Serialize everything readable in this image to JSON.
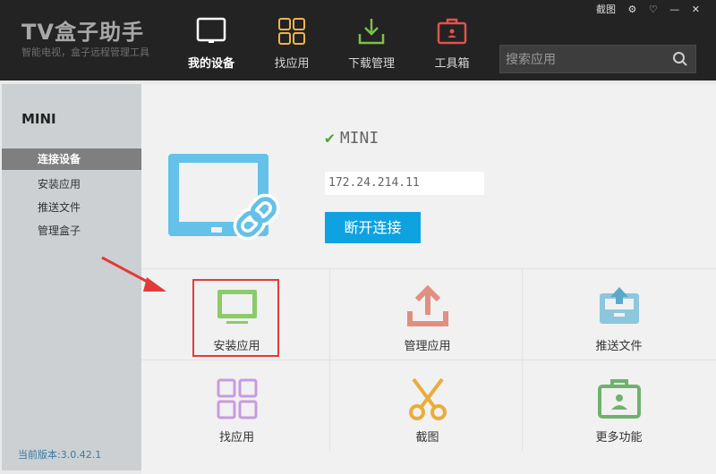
{
  "app": {
    "title": "TV盒子助手",
    "subtitle": "智能电视，盒子远程管理工具",
    "window_controls": [
      "截图",
      "⚙",
      "♡",
      "—",
      "✕"
    ]
  },
  "nav": [
    {
      "label": "我的设备",
      "icon": "tablet-icon",
      "active": true
    },
    {
      "label": "找应用",
      "icon": "grid-apps-icon",
      "active": false
    },
    {
      "label": "下载管理",
      "icon": "download-icon",
      "active": false
    },
    {
      "label": "工具箱",
      "icon": "toolbox-icon",
      "active": false
    }
  ],
  "search": {
    "placeholder": "搜索应用"
  },
  "sidebar": {
    "title": "MINI",
    "items": [
      {
        "label": "连接设备",
        "active": true
      },
      {
        "label": "安装应用",
        "active": false
      },
      {
        "label": "推送文件",
        "active": false
      },
      {
        "label": "管理盒子",
        "active": false
      }
    ],
    "version": "当前版本:3.0.42.1"
  },
  "device": {
    "name": "MINI",
    "ip": "172.24.214.11",
    "disconnect_label": "断开连接"
  },
  "tiles": [
    {
      "label": "安装应用",
      "icon": "monitor-install-icon"
    },
    {
      "label": "管理应用",
      "icon": "upload-manage-icon"
    },
    {
      "label": "推送文件",
      "icon": "tray-push-icon"
    },
    {
      "label": "找应用",
      "icon": "grid-find-icon"
    },
    {
      "label": "截图",
      "icon": "scissors-icon"
    },
    {
      "label": "更多功能",
      "icon": "toolbox-more-icon"
    }
  ],
  "colors": {
    "accent": "#0ea3e0",
    "topbar": "#232323",
    "highlight": "#e23a3a"
  }
}
